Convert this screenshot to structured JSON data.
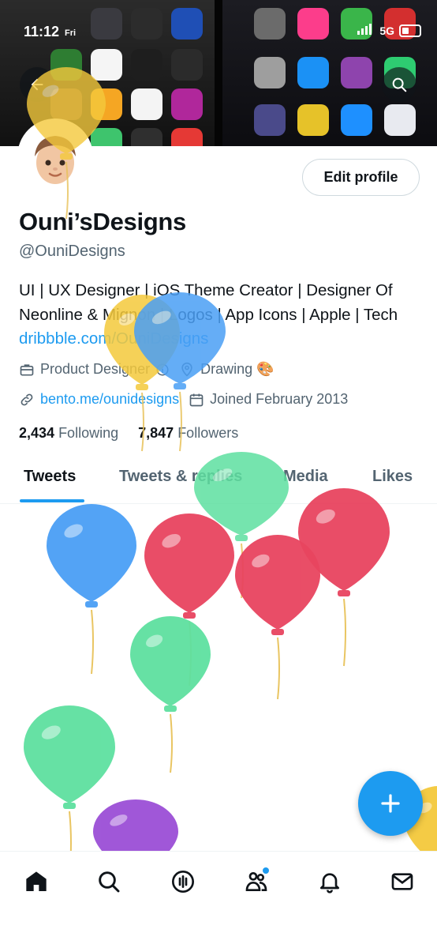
{
  "status_bar": {
    "time": "11:12",
    "day": "Fri",
    "network": "5G"
  },
  "banner": {
    "back_icon": "arrow-left-icon",
    "search_icon": "search-icon",
    "app_colors": [
      "#3a3a40",
      "#2c2c2c",
      "#1f4fb5",
      "#2e7d32",
      "#f5f5f5",
      "#1e1e1e",
      "#2b2b2b",
      "#6d4c41",
      "#f5a623",
      "#f4f4f4",
      "#b0279b",
      "#1976d2",
      "#3ec46d",
      "#2f2f2f",
      "#e53935",
      "#6b6b6b",
      "#fc3d8b",
      "#3ab54a",
      "#d32f2f",
      "#9e9e9e",
      "#1b91f5",
      "#8e44ad",
      "#2ecc71",
      "#4a4a8a",
      "#e6c229",
      "#1e90ff",
      "#e8eaf0",
      "#2b2b2b"
    ]
  },
  "profile": {
    "avatar_icon": "memoji-avatar",
    "edit_label": "Edit profile",
    "name": "Ouni’sDesigns",
    "handle": "@OuniDesigns",
    "bio_text": "UI | UX Designer | iOS Theme Creator | Designer Of Neonline & Mignon | Logos | App Icons | Apple | Tech ",
    "bio_link": "dribbble.com/OuniDesigns",
    "category": "Product Designer",
    "location": "Drawing 🎨",
    "website": "bento.me/ounidesigns",
    "joined": "Joined February 2013",
    "following_count": "2,434",
    "following_label": "Following",
    "followers_count": "7,847",
    "followers_label": "Followers"
  },
  "tabs": [
    {
      "label": "Tweets",
      "active": true
    },
    {
      "label": "Tweets & replies",
      "active": false
    },
    {
      "label": "Media",
      "active": false
    },
    {
      "label": "Likes",
      "active": false
    }
  ],
  "fab_icon": "plus-icon",
  "bottom_nav": [
    {
      "icon": "home-icon"
    },
    {
      "icon": "search-icon"
    },
    {
      "icon": "spaces-icon"
    },
    {
      "icon": "communities-icon"
    },
    {
      "icon": "bell-icon"
    },
    {
      "icon": "mail-icon"
    }
  ],
  "colors": {
    "accent": "#1d9bf0",
    "text": "#0f1419",
    "secondary": "#536471",
    "balloon_blue": "#4a9ff5",
    "balloon_red": "#e8445f",
    "balloon_green": "#5ee0a0",
    "balloon_yellow": "#f4c93c",
    "balloon_purple": "#9b4fd6"
  }
}
